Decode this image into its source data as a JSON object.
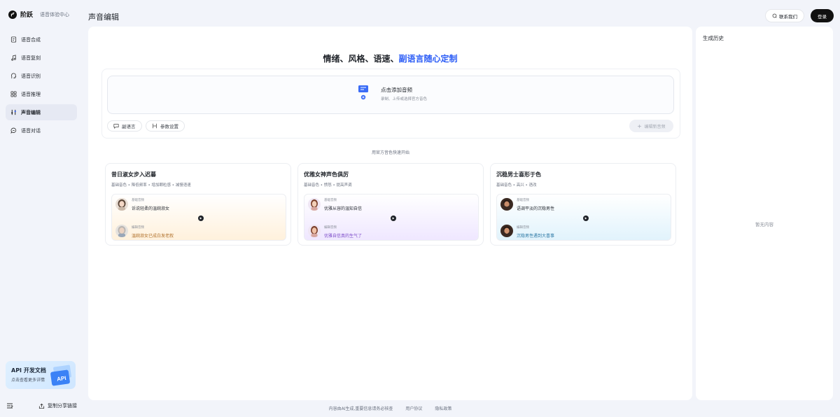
{
  "brand": {
    "name": "阶跃",
    "subtitle": "语音体验中心"
  },
  "nav": {
    "items": [
      {
        "label": "语音合成",
        "icon": "document-audio-icon"
      },
      {
        "label": "语音复刻",
        "icon": "music-note-icon"
      },
      {
        "label": "语音识别",
        "icon": "speaking-head-icon"
      },
      {
        "label": "语音推理",
        "icon": "grid-icon"
      },
      {
        "label": "声音编辑",
        "icon": "sliders-icon",
        "active": true
      },
      {
        "label": "语音对话",
        "icon": "chat-bubble-icon"
      }
    ]
  },
  "api_card": {
    "title": "API 开发文档",
    "subtitle": "点击查看更多详情"
  },
  "sidebar_bottom": {
    "share_label": "复制分享链接"
  },
  "header": {
    "title": "声音编辑",
    "contact_label": "联系我们",
    "login_label": "登录"
  },
  "hero": {
    "prefix": "情绪、风格、语速、",
    "accent": "副语言随心定制",
    "accent_color": "#2b5cf6"
  },
  "upload": {
    "title": "点击添加音频",
    "subtitle": "录制、上传或选择官方音色"
  },
  "toolbar": {
    "paralanguage_label": "副语言",
    "params_label": "参数设置",
    "generate_label": "编辑新音频"
  },
  "quick_start": {
    "label": "用官方音色快速开始"
  },
  "cards": [
    {
      "title": "昔日淑女步入迟暮",
      "tags": "基础音色 • 降低频率 • 增加颗粒感 • 减慢语速",
      "base_label": "基础音频",
      "base_text": "诉说轻柔的温婉淑女",
      "edited_label": "编辑音频",
      "edited_text": "温婉淑女已成白发老叙"
    },
    {
      "title": "优雅女神声色俱厉",
      "tags": "基础音色 • 愤怒 • 提高声调",
      "base_label": "基础音频",
      "base_text": "优雅从容的温知自信",
      "edited_label": "编辑音频",
      "edited_text": "优雅自信真的生气了"
    },
    {
      "title": "沉稳男士喜形于色",
      "tags": "基础音色 • 高兴 • 语改",
      "base_label": "基础音频",
      "base_text": "语调平淡的沉稳男性",
      "edited_label": "编辑音频",
      "edited_text": "沉稳男性遇到大喜事"
    }
  ],
  "history": {
    "title": "生成历史",
    "empty_text": "暂无内容"
  },
  "footer": {
    "disclaimer": "内容由AI生成,重要信息请务必核查",
    "user_agreement": "用户协议",
    "privacy_policy": "隐私政策"
  }
}
